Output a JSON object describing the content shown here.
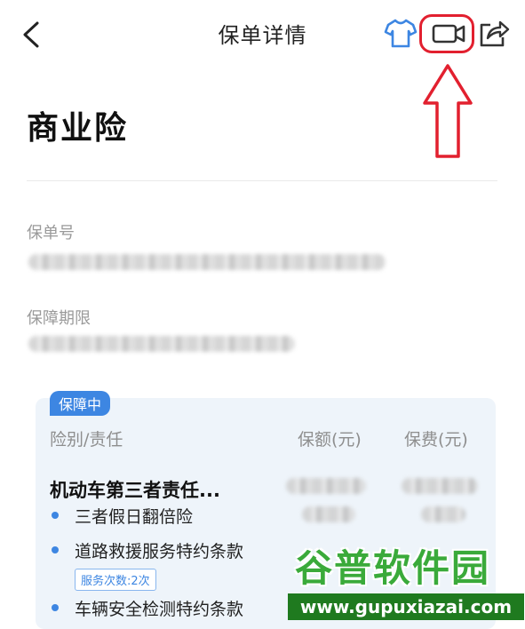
{
  "navbar": {
    "title": "保单详情",
    "icons": [
      "back-icon",
      "shirt-icon",
      "video-icon",
      "share-icon"
    ],
    "accent_color": "#3d86e2"
  },
  "annotation": {
    "color": "#e2202f"
  },
  "page": {
    "title": "商业险"
  },
  "policy": {
    "number_label": "保单号",
    "period_label": "保障期限"
  },
  "coverage": {
    "status_badge": "保障中",
    "headers": {
      "type": "险别/责任",
      "amount": "保额(元)",
      "premium": "保费(元)"
    },
    "item_title": "机动车第三者责任...",
    "sub_items": [
      "三者假日翻倍险",
      "道路救援服务特约条款",
      "车辆安全检测特约条款"
    ],
    "service_tag": "服务次数:2次"
  },
  "watermark": {
    "logo_text": "谷普软件园",
    "url": "www.gupuxiazai.com"
  }
}
